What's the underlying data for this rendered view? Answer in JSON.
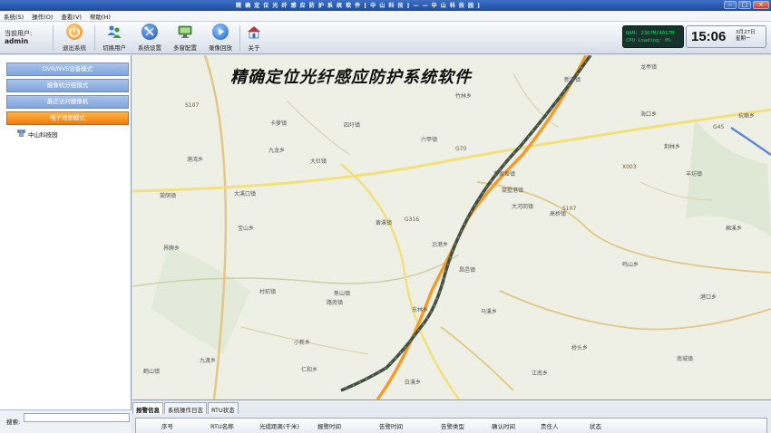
{
  "window": {
    "title": "精 确 定 位 光 纤 感 应 防 护 系 统 软 件 [ 中 山 科 技 ] — — 中 山 科 技 园 ]"
  },
  "menu": [
    {
      "label": "系统(S)"
    },
    {
      "label": "操作(O)"
    },
    {
      "label": "查看(V)"
    },
    {
      "label": "帮助(H)"
    }
  ],
  "user": {
    "label": "当前用户:",
    "name": "admin"
  },
  "toolbar": [
    {
      "label": "退出系统",
      "icon": "power-icon",
      "color": "#f08a1c"
    },
    {
      "label": "切换用户",
      "icon": "users-icon",
      "color": "#3f8e3a"
    },
    {
      "label": "系统设置",
      "icon": "tools-icon",
      "color": "#2b66c8"
    },
    {
      "label": "多窗配置",
      "icon": "monitor-icon",
      "color": "#3f9a3a"
    },
    {
      "label": "录像回放",
      "icon": "play-icon",
      "color": "#1f65cf"
    },
    {
      "label": "关于",
      "icon": "home-icon",
      "color": "#2f6fc9"
    }
  ],
  "status": {
    "ram": "RAM: 2367M/4017M",
    "cpu": "CPU Loading: 0%"
  },
  "clock": {
    "time": "15:06",
    "date": "3月27日",
    "weekday": "星期一"
  },
  "sidebar": {
    "modes": [
      {
        "label": "DVR/NVS设备模式",
        "active": false
      },
      {
        "label": "摄像机分组模式",
        "active": false
      },
      {
        "label": "最近访问摄像机",
        "active": false
      },
      {
        "label": "电子地图模式",
        "active": true
      }
    ],
    "tree": [
      {
        "label": "中山科技园",
        "icon": "network-icon"
      }
    ],
    "search_label": "搜索:",
    "search_value": ""
  },
  "map": {
    "title": "精确定位光纤感应防护系统软件",
    "places": [
      "卡萝镇",
      "四圩镇",
      "六甲镇",
      "大社镇",
      "棠荫镇",
      "大溪口镇",
      "黄家埠镇",
      "棠墅港镇",
      "大河岗镇",
      "高桥镇",
      "荆林乡",
      "羊坊镇",
      "棉溪乡",
      "鸣山乡",
      "杭嘶乡",
      "龙亭镇",
      "村前镇",
      "路南镇",
      "东林乡",
      "马溪乡",
      "桥头乡",
      "仁和乡",
      "鹤山镇",
      "焦山镇",
      "港口乡",
      "九渡乡",
      "宝山乡",
      "小新乡",
      "九龙乡",
      "竹林乡",
      "新港镇",
      "昌邑镇",
      "江南乡",
      "港湾乡",
      "黄溪镇",
      "沿港乡",
      "海口乡",
      "界牌乡",
      "南城镇",
      "白溪乡"
    ],
    "roads": [
      "S107",
      "S107",
      "G45",
      "G70",
      "G316",
      "X003"
    ]
  },
  "bottom": {
    "tabs": [
      {
        "label": "报警信息",
        "active": true
      },
      {
        "label": "系统操作日志",
        "active": false
      },
      {
        "label": "RTU状态",
        "active": false
      }
    ],
    "columns": [
      "序号",
      "RTU名称",
      "光缆距离(千米)",
      "报警时间",
      "告警时间",
      "告警类型",
      "确认时间",
      "责任人",
      "状态"
    ]
  }
}
